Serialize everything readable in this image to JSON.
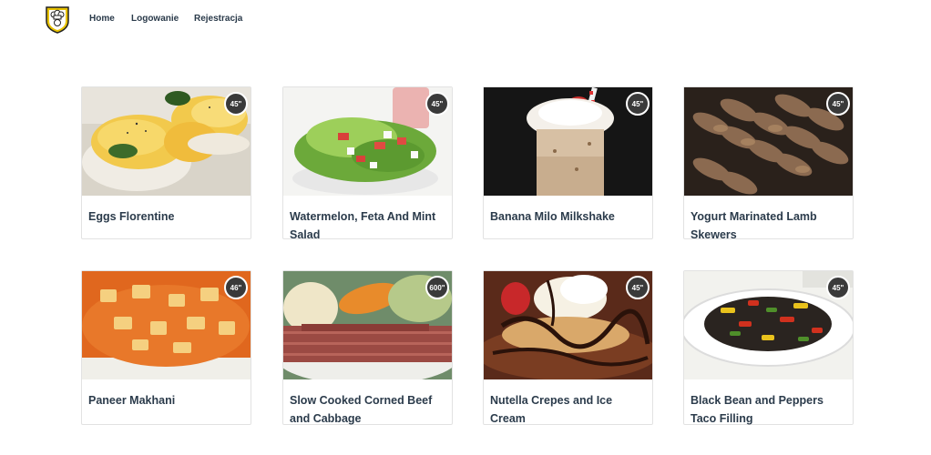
{
  "nav": {
    "home": "Home",
    "login": "Logowanie",
    "register": "Rejestracja"
  },
  "recipes": [
    {
      "title": "Eggs Florentine",
      "time": "45\"",
      "photo": "eggs-florentine-photo"
    },
    {
      "title": "Watermelon, Feta And Mint Salad",
      "time": "45\"",
      "photo": "salad-photo"
    },
    {
      "title": "Banana Milo Milkshake",
      "time": "45\"",
      "photo": "milkshake-photo"
    },
    {
      "title": "Yogurt Marinated Lamb Skewers",
      "time": "45\"",
      "photo": "lamb-skewers-photo"
    },
    {
      "title": "Paneer Makhani",
      "time": "46\"",
      "photo": "paneer-makhani-photo"
    },
    {
      "title": "Slow Cooked Corned Beef and Cabbage",
      "time": "600\"",
      "photo": "corned-beef-photo"
    },
    {
      "title": "Nutella Crepes and Ice Cream",
      "time": "45\"",
      "photo": "crepes-photo"
    },
    {
      "title": "Black Bean and Peppers Taco Filling",
      "time": "45\"",
      "photo": "taco-filling-photo"
    }
  ],
  "colors": {
    "nav_text": "#2a3a4a",
    "card_title": "#2b3b4b",
    "badge_bg": "#3a3a3a",
    "logo_gold": "#e8c200"
  }
}
